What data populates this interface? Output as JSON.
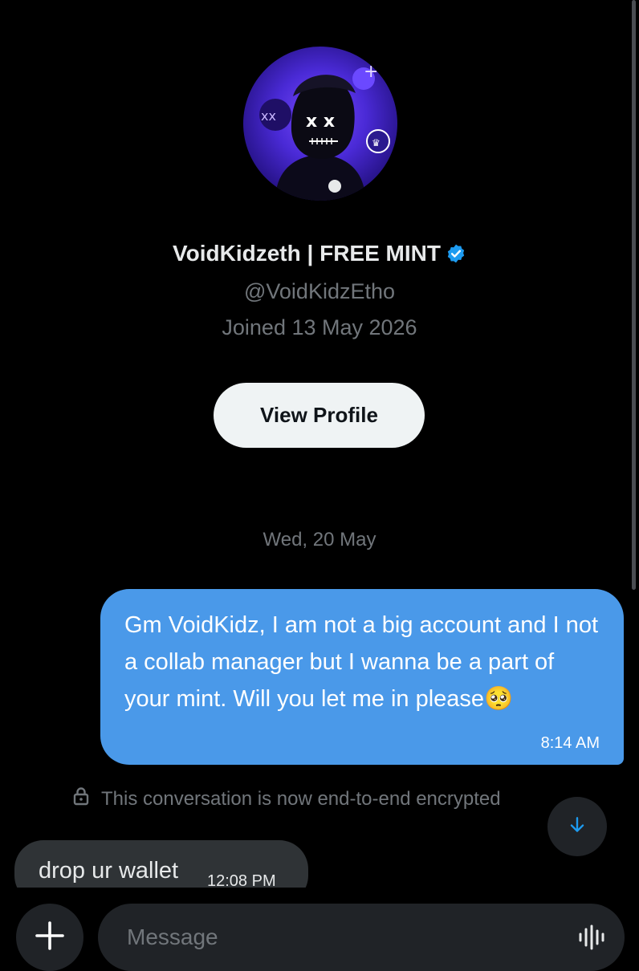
{
  "profile": {
    "display_name": "VoidKidzeth | FREE MINT",
    "handle": "@VoidKidzEtho",
    "joined": "Joined 13 May 2026",
    "view_profile_label": "View Profile"
  },
  "conversation": {
    "date_separator": "Wed, 20 May",
    "messages": [
      {
        "direction": "outgoing",
        "text": "Gm VoidKidz, I am not a big account and I not a collab manager but I wanna be a part of your mint. Will you let me in please🥺",
        "time": "8:14 AM"
      },
      {
        "direction": "incoming",
        "text": "drop ur wallet",
        "time": "12:08 PM"
      }
    ],
    "encryption_notice": "This conversation is now end-to-end encrypted"
  },
  "composer": {
    "placeholder": "Message"
  },
  "icons": {
    "verified": "verified-badge-icon",
    "lock": "lock-icon",
    "scroll_down": "arrow-down-icon",
    "add": "plus-icon",
    "voice": "voice-wave-icon"
  },
  "colors": {
    "background": "#000000",
    "accent": "#1d9bf0",
    "outgoing_bubble": "#4a99e9",
    "incoming_bubble": "#2f3336",
    "muted_text": "#71767b"
  }
}
